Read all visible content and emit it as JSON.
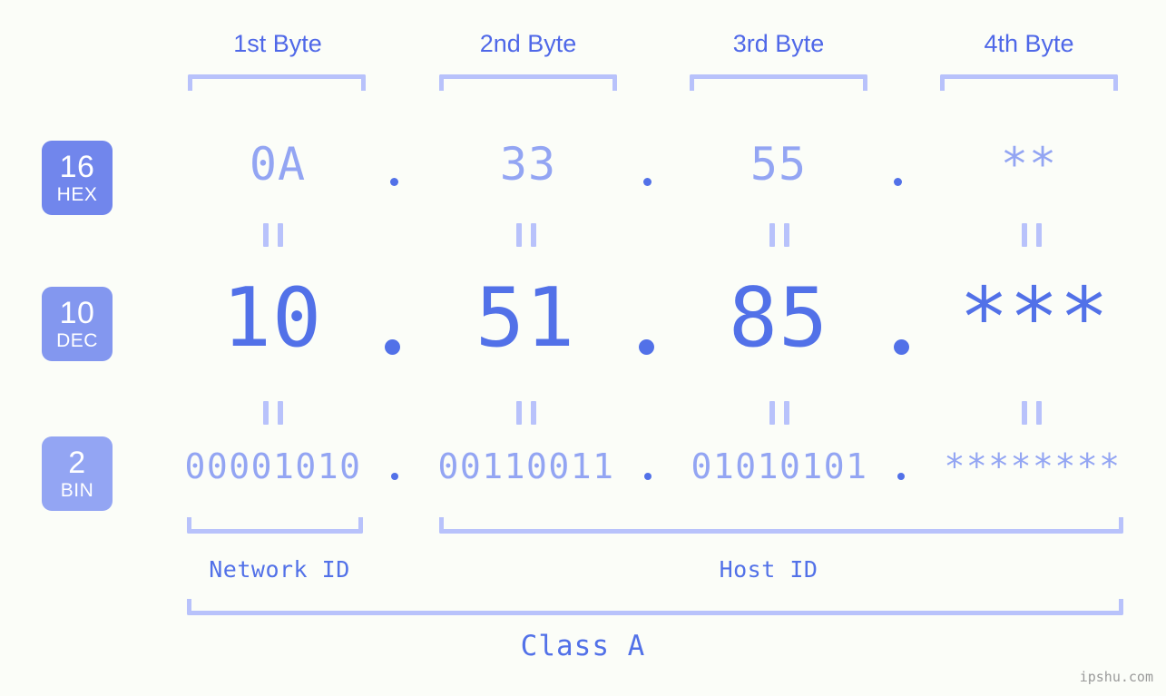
{
  "page": {
    "background_color": "#fbfdf8",
    "accent_strong": "#5271e8",
    "accent_light": "#93a5f3",
    "accent_pale": "#b8c2fb",
    "watermark": "ipshu.com"
  },
  "columns": {
    "headers": [
      {
        "label": "1st Byte"
      },
      {
        "label": "2nd Byte"
      },
      {
        "label": "3rd Byte"
      },
      {
        "label": "4th Byte"
      }
    ]
  },
  "bases": [
    {
      "number": "16",
      "name": "HEX",
      "color": "#7186ec"
    },
    {
      "number": "10",
      "name": "DEC",
      "color": "#8397ef"
    },
    {
      "number": "2",
      "name": "BIN",
      "color": "#93a5f3"
    }
  ],
  "rows": {
    "hex": {
      "base_number": "16",
      "base_name": "HEX",
      "values": [
        "0A",
        "33",
        "55",
        "**"
      ],
      "separators": [
        ".",
        ".",
        "."
      ]
    },
    "dec": {
      "base_number": "10",
      "base_name": "DEC",
      "values": [
        "10",
        "51",
        "85",
        "***"
      ],
      "separators": [
        ".",
        ".",
        "."
      ]
    },
    "bin": {
      "base_number": "2",
      "base_name": "BIN",
      "values": [
        "00001010",
        "00110011",
        "01010101",
        "********"
      ],
      "separators": [
        ".",
        ".",
        "."
      ]
    }
  },
  "equality_markers": {
    "glyph": "||",
    "count_top": 4,
    "count_bottom": 4
  },
  "segments": {
    "network_id": {
      "label": "Network ID"
    },
    "host_id": {
      "label": "Host ID"
    },
    "class": {
      "label": "Class A"
    }
  }
}
